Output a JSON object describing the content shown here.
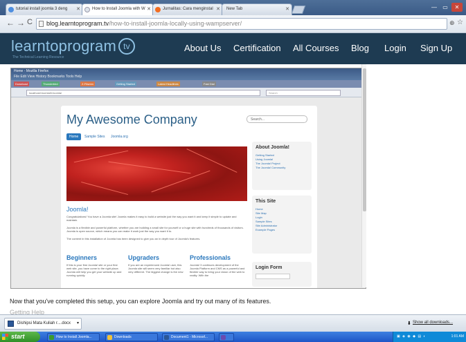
{
  "browser": {
    "tabs": [
      {
        "label": "tutorial install joomla 3 deng",
        "active": false,
        "fav": "#4f8fe0"
      },
      {
        "label": "How to Install Joomla with W",
        "active": true,
        "fav": "#9ab"
      },
      {
        "label": "Jurnalitas: Cara menginstal",
        "active": false,
        "fav": "#f26d21"
      },
      {
        "label": "New Tab",
        "active": false,
        "fav": ""
      }
    ],
    "address": {
      "host": "blog.learntoprogram.tv",
      "path": "/how-to-install-joomla-locally-using-wampserver/"
    }
  },
  "site": {
    "logo_text": "learntoprogram",
    "logo_badge": "tv",
    "tagline": "The Technical Learning Resource",
    "nav": [
      "About Us",
      "Certification",
      "All Courses",
      "Blog",
      "Login",
      "Sign Up"
    ]
  },
  "screenshot": {
    "window_title": "Home - Mozilla Firefox",
    "menu": "File  Edit  View  History  Bookmarks  Tools  Help",
    "bookmarks": [
      "Download",
      "Thunderbird",
      "Z-Fitsmm",
      "Getting Started",
      "Latest Headlines",
      "Fast Dial"
    ],
    "url": "localhost/Joomla3/Joomla/",
    "search_placeholder": "Search",
    "site_title": "My Awesome Company",
    "site_search": "Search...",
    "nav": [
      "Home",
      "Sample Sites",
      "Joomla.org"
    ],
    "about_title": "About Joomla!",
    "about_links": [
      "Getting Started",
      "Using Joomla!",
      "The Joomla! Project",
      "The Joomla! Community"
    ],
    "this_site_title": "This Site",
    "this_site_links": [
      "Home",
      "Site Map",
      "Login",
      "Sample Sites",
      "Site Administrator",
      "Example Pages"
    ],
    "login_title": "Login Form",
    "heading": "Joomla!",
    "para1": "Congratulations! You have a Joomla site! Joomla makes it easy to build a website just the way you want it and keep it simple to update and maintain.",
    "para2": "Joomla is a flexible and powerful platform, whether you are building a small site for yourself or a huge site with hundreds of thousands of visitors. Joomla is open source, which means you can make it work just the way you want it to.",
    "para3": "The content in this installation of Joomla has been designed to give you an in depth tour of Joomla's features.",
    "columns": [
      {
        "title": "Beginners",
        "text": "If this is your first Joomla! site or your first web site, you have come to the right place. Joomla will help you get your website up and running quickly"
      },
      {
        "title": "Upgraders",
        "text": "If you are an experienced Joomla! user, this Joomla site will seem very familiar but also very different. The biggest change is the new"
      },
      {
        "title": "Professionals",
        "text": "Joomla! 3 continues development of the Joomla Platform and CMS as a powerful and flexible way to bring your vision of the web to reality. With the"
      }
    ]
  },
  "article": {
    "caption": "Now that you've completed this setup, you can explore Joomla and try out many of its features.",
    "next_heading": "Getting Help"
  },
  "downloads": {
    "item": "Dishipsi Mata Kuliah r....docx",
    "show_all": "Show all downloads..."
  },
  "taskbar": {
    "start": "start",
    "items": [
      {
        "label": "How to Install Joomla...",
        "color": "#3b9a2e"
      },
      {
        "label": "Downloads",
        "color": "#f0c23b"
      },
      {
        "label": "Document1 - Microsof...",
        "color": "#2b5797"
      },
      {
        "label": "",
        "color": "#6a4bb0"
      }
    ],
    "clock": "1:01 AM"
  }
}
